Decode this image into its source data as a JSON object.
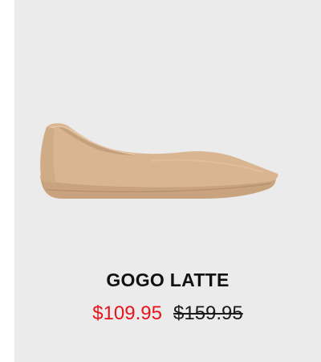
{
  "product": {
    "name": "GOGO LATTE",
    "sale_price": "$109.95",
    "original_price": "$159.95",
    "image_icon": "shoe-icon"
  },
  "colors": {
    "card_background": "#ebebeb",
    "shoe": "#d9b691",
    "sale_price": "#e8141b",
    "text": "#111111"
  }
}
